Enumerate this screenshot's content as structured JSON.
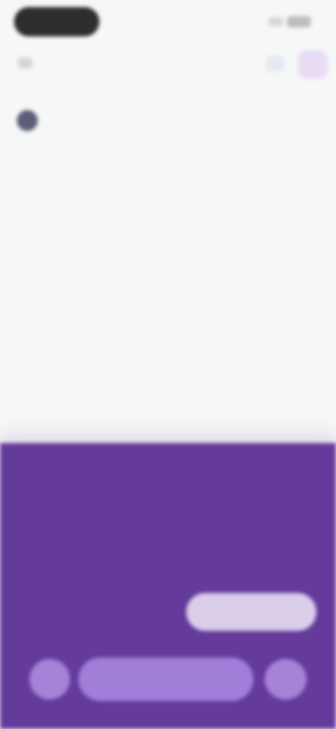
{
  "header": {
    "title": "",
    "back_icon": "back-arrow-icon",
    "action_icons": [
      "share-icon",
      "profile-icon"
    ]
  },
  "account": {
    "avatar_icon": "account-avatar-icon",
    "name": ""
  },
  "links": {
    "primary": "",
    "secondary": ""
  },
  "article": {
    "title": "",
    "body": ""
  },
  "consent": {
    "heading": "",
    "body": "",
    "option_label": "",
    "option_button": "",
    "accept_button": "",
    "left_icon": "settings-icon",
    "right_icon": "info-icon"
  },
  "colors": {
    "background": "#f6f7f7",
    "panel": "#643a9a",
    "accent": "#a17ed8",
    "option_button": "#d9cdea"
  }
}
